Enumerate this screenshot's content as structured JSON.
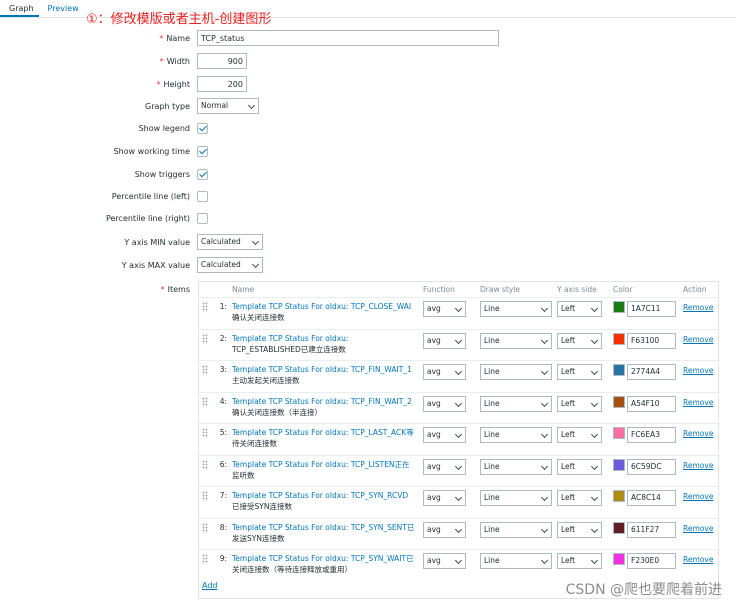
{
  "tabs": [
    {
      "label": "Graph",
      "active": true
    },
    {
      "label": "Preview",
      "active": false
    }
  ],
  "annotation": "①：修改模版或者主机-创建图形",
  "form": {
    "name": {
      "label": "Name",
      "value": "TCP_status"
    },
    "width": {
      "label": "Width",
      "value": "900"
    },
    "height": {
      "label": "Height",
      "value": "200"
    },
    "graph_type": {
      "label": "Graph type",
      "value": "Normal"
    },
    "show_legend": {
      "label": "Show legend",
      "checked": true
    },
    "show_working_time": {
      "label": "Show working time",
      "checked": true
    },
    "show_triggers": {
      "label": "Show triggers",
      "checked": true
    },
    "percentile_left": {
      "label": "Percentile line (left)",
      "checked": false
    },
    "percentile_right": {
      "label": "Percentile line (right)",
      "checked": false
    },
    "y_min": {
      "label": "Y axis MIN value",
      "value": "Calculated"
    },
    "y_max": {
      "label": "Y axis MAX value",
      "value": "Calculated"
    },
    "items_label": "Items"
  },
  "items_table": {
    "headers": {
      "name": "Name",
      "function": "Function",
      "draw_style": "Draw style",
      "y_axis_side": "Y axis side",
      "color": "Color",
      "action": "Action"
    },
    "rows": [
      {
        "idx": "1:",
        "name1": "Template TCP Status For oldxu: TCP_CLOSE_WAI",
        "name2": "确认关闭连接数",
        "function": "avg",
        "draw_style": "Line",
        "y_axis": "Left",
        "color": "1A7C11",
        "remove": "Remove"
      },
      {
        "idx": "2:",
        "name1": "Template TCP Status For oldxu:",
        "name2": "TCP_ESTABLISHED已建立连接数",
        "function": "avg",
        "draw_style": "Line",
        "y_axis": "Left",
        "color": "F63100",
        "remove": "Remove"
      },
      {
        "idx": "3:",
        "name1": "Template TCP Status For oldxu: TCP_FIN_WAIT_1",
        "name2": "主动发起关闭连接数",
        "function": "avg",
        "draw_style": "Line",
        "y_axis": "Left",
        "color": "2774A4",
        "remove": "Remove"
      },
      {
        "idx": "4:",
        "name1": "Template TCP Status For oldxu: TCP_FIN_WAIT_2",
        "name2": "确认关闭连接数（半连接）",
        "function": "avg",
        "draw_style": "Line",
        "y_axis": "Left",
        "color": "A54F10",
        "remove": "Remove"
      },
      {
        "idx": "5:",
        "name1": "Template TCP Status For oldxu: TCP_LAST_ACK等",
        "name2": "待关闭连接数",
        "function": "avg",
        "draw_style": "Line",
        "y_axis": "Left",
        "color": "FC6EA3",
        "remove": "Remove"
      },
      {
        "idx": "6:",
        "name1": "Template TCP Status For oldxu: TCP_LISTEN正在",
        "name2": "监听数",
        "function": "avg",
        "draw_style": "Line",
        "y_axis": "Left",
        "color": "6C59DC",
        "remove": "Remove"
      },
      {
        "idx": "7:",
        "name1": "Template TCP Status For oldxu: TCP_SYN_RCVD",
        "name2": "已接受SYN连接数",
        "function": "avg",
        "draw_style": "Line",
        "y_axis": "Left",
        "color": "AC8C14",
        "remove": "Remove"
      },
      {
        "idx": "8:",
        "name1": "Template TCP Status For oldxu: TCP_SYN_SENT已",
        "name2": "发送SYN连接数",
        "function": "avg",
        "draw_style": "Line",
        "y_axis": "Left",
        "color": "611F27",
        "remove": "Remove"
      },
      {
        "idx": "9:",
        "name1": "Template TCP Status For oldxu: TCP_SYN_WAIT已",
        "name2": "关闭连接数（等待连接释放或重用）",
        "function": "avg",
        "draw_style": "Line",
        "y_axis": "Left",
        "color": "F230E0",
        "remove": "Remove"
      }
    ],
    "add_label": "Add"
  },
  "watermark": "CSDN @爬也要爬着前进"
}
